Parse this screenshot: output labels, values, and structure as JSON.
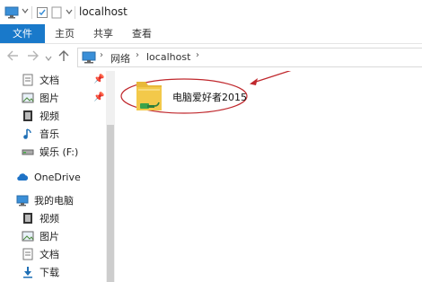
{
  "title": {
    "path_text": "localhost"
  },
  "ribbon": {
    "tabs": [
      "文件",
      "主页",
      "共享",
      "查看"
    ]
  },
  "address": {
    "crumbs": [
      "网络",
      "localhost"
    ]
  },
  "sidebar": {
    "quick_access": [
      {
        "label": "文档",
        "icon": "documents-icon"
      },
      {
        "label": "图片",
        "icon": "pictures-icon"
      },
      {
        "label": "视频",
        "icon": "videos-icon"
      },
      {
        "label": "音乐",
        "icon": "music-icon"
      },
      {
        "label": "娱乐 (F:)",
        "icon": "drive-icon"
      }
    ],
    "onedrive": {
      "label": "OneDrive",
      "icon": "cloud-icon"
    },
    "this_pc": {
      "label": "我的电脑",
      "icon": "computer-icon"
    },
    "this_pc_items": [
      {
        "label": "视频",
        "icon": "videos-icon"
      },
      {
        "label": "图片",
        "icon": "pictures-icon"
      },
      {
        "label": "文档",
        "icon": "documents-icon"
      },
      {
        "label": "下载",
        "icon": "download-icon"
      }
    ]
  },
  "content": {
    "folder_label": "电脑爱好者2015"
  },
  "colors": {
    "accent": "#1979ca",
    "annotation": "#c0282d",
    "folder": "#f3c94a"
  }
}
